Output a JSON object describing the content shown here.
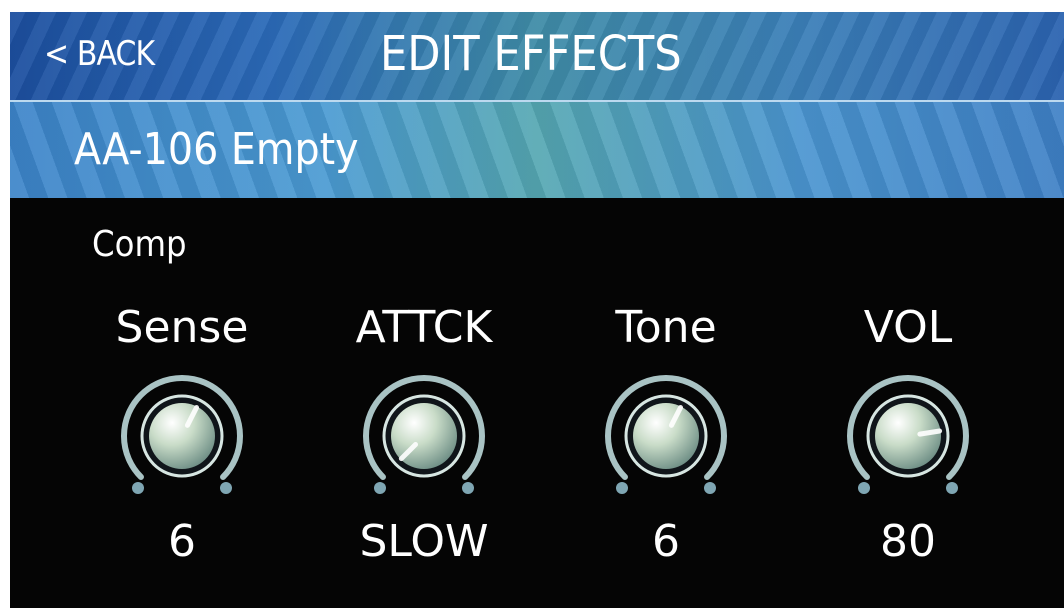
{
  "header": {
    "back_label": "< BACK",
    "title": "EDIT EFFECTS"
  },
  "preset": {
    "name": "AA-106 Empty"
  },
  "effect": {
    "name": "Comp",
    "params": [
      {
        "label": "Sense",
        "value": "6",
        "level": 0.6
      },
      {
        "label": "ATTCK",
        "value": "SLOW",
        "level": 0.0
      },
      {
        "label": "Tone",
        "value": "6",
        "level": 0.6
      },
      {
        "label": "VOL",
        "value": "80",
        "level": 0.8
      }
    ]
  },
  "colors": {
    "header_blue": "#2b6ab8",
    "subbar_blue": "#4a9ad2",
    "background": "#050505",
    "text": "#ffffff"
  }
}
